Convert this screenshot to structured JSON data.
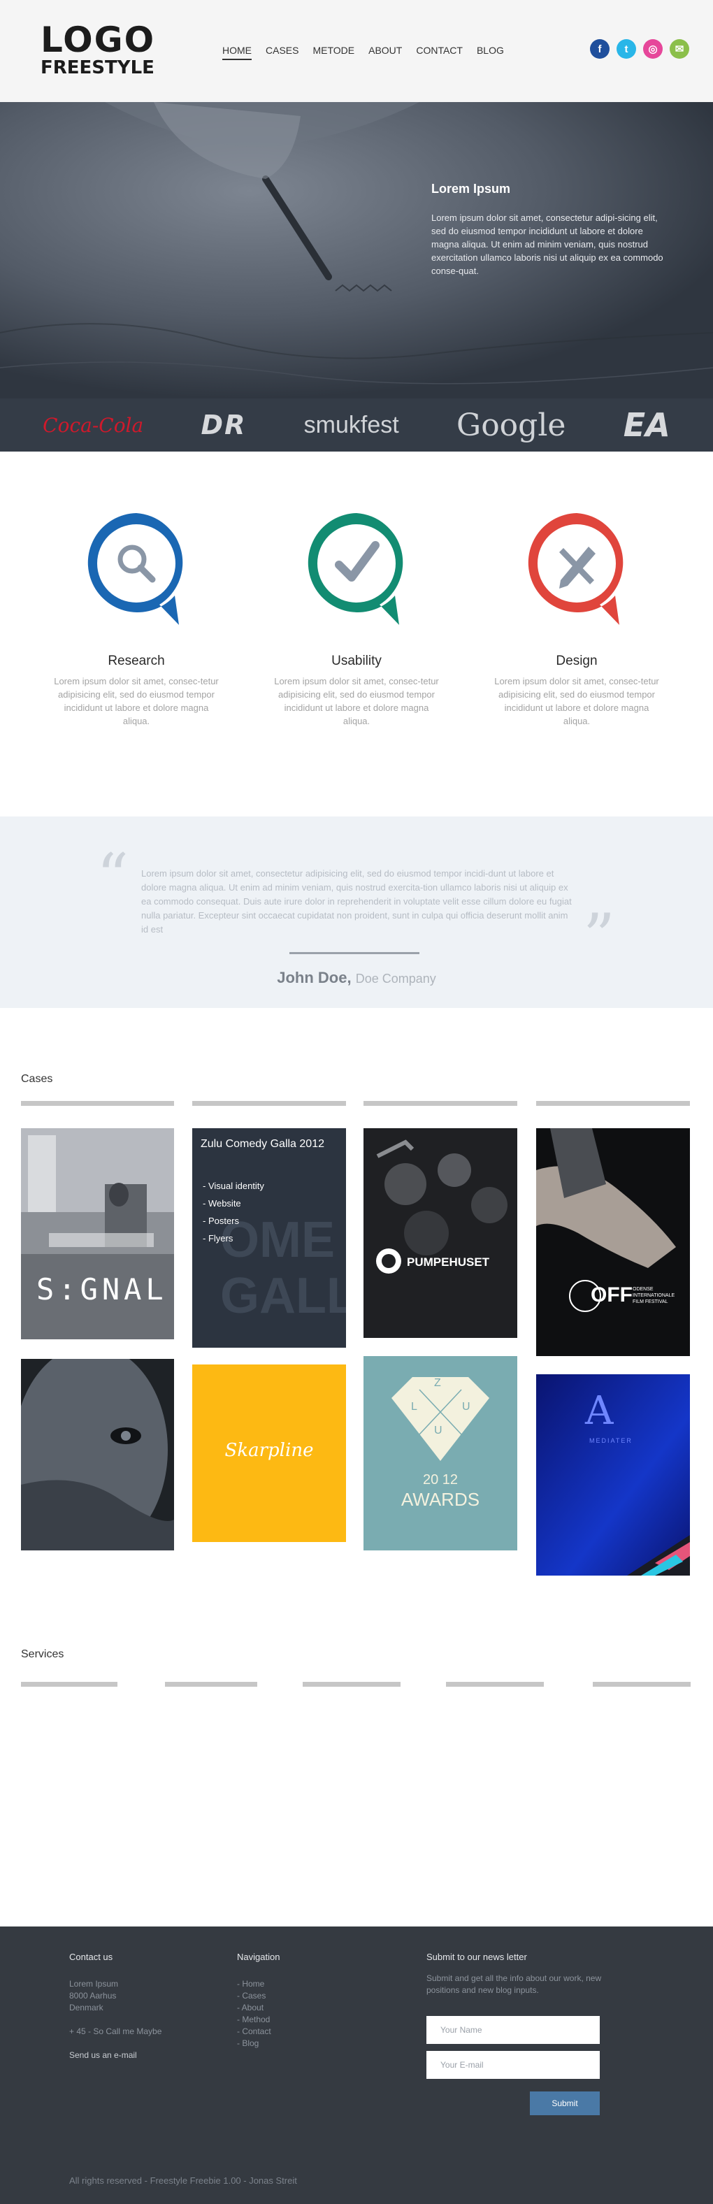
{
  "header": {
    "logo_main": "LOGO",
    "logo_sub": "FREESTYLE",
    "nav": [
      "HOME",
      "CASES",
      "METODE",
      "ABOUT",
      "CONTACT",
      "BLOG"
    ],
    "active_nav": "HOME",
    "social": [
      {
        "icon": "facebook-icon",
        "glyph": "f",
        "color": "#1f4f9c"
      },
      {
        "icon": "twitter-icon",
        "glyph": "t",
        "color": "#29b6e8"
      },
      {
        "icon": "dribbble-icon",
        "glyph": "◎",
        "color": "#e6479a"
      },
      {
        "icon": "mail-icon",
        "glyph": "✉",
        "color": "#8bbf4a"
      }
    ]
  },
  "hero": {
    "title": "Lorem Ipsum",
    "text": "Lorem ipsum dolor sit amet, consectetur adipi-sicing elit, sed do eiusmod tempor incididunt ut labore et dolore magna aliqua. Ut enim ad minim veniam, quis nostrud exercitation ullamco laboris nisi ut aliquip ex ea commodo conse-quat."
  },
  "clients": [
    "Coca-Cola",
    "DR",
    "smukfest",
    "Google",
    "EA"
  ],
  "features": [
    {
      "title": "Research",
      "icon": "search-icon",
      "color": "#1a67b3",
      "text": "Lorem ipsum dolor sit amet, consec-tetur adipisicing elit, sed do eiusmod tempor incididunt ut labore et dolore magna aliqua."
    },
    {
      "title": "Usability",
      "icon": "checkmark-icon",
      "color": "#128c72",
      "text": "Lorem ipsum dolor sit amet, consec-tetur adipisicing elit, sed do eiusmod tempor incididunt ut labore et dolore magna aliqua."
    },
    {
      "title": "Design",
      "icon": "pencil-brush-icon",
      "color": "#e0453c",
      "text": "Lorem ipsum dolor sit amet, consec-tetur adipisicing elit, sed do eiusmod tempor incididunt ut labore et dolore magna aliqua."
    }
  ],
  "testimonial": {
    "text": "Lorem ipsum dolor sit amet, consectetur adipisicing elit, sed do eiusmod tempor incidi-dunt ut labore et dolore magna aliqua. Ut enim ad minim veniam, quis nostrud exercita-tion ullamco laboris nisi ut aliquip ex ea commodo consequat. Duis aute irure dolor in reprehenderit in voluptate velit esse cillum dolore eu fugiat nulla pariatur. Excepteur sint occaecat cupidatat non proident, sunt in culpa qui officia deserunt mollit anim id est",
    "author": "John Doe,",
    "company": "Doe Company"
  },
  "cases": {
    "title": "Cases",
    "signal_label": "S:GNAL",
    "zulu_title": "Zulu Comedy Galla 2012",
    "zulu_items": [
      "- Visual identity",
      "- Website",
      "- Posters",
      "- Flyers"
    ],
    "pumpehuset_label": "PUMPEHUSET",
    "off_label": "OFF",
    "off_sub": "ODENSE INTERNATIONALE FILM FESTIVAL",
    "skarpline_label": "Skarpline",
    "awards_top": "20  12",
    "awards_label": "AWARDS",
    "awards_letters": [
      "Z",
      "L",
      "X",
      "U",
      "U"
    ],
    "mediater_letter": "A",
    "mediater_label": "MEDIATER"
  },
  "services": {
    "title": "Services"
  },
  "footer": {
    "contact_title": "Contact us",
    "address": [
      "Lorem Ipsum",
      "8000 Aarhus",
      "Denmark"
    ],
    "phone": "+ 45 - So Call me Maybe",
    "email_link": "Send us an e-mail",
    "nav_title": "Navigation",
    "nav_items": [
      "- Home",
      "- Cases",
      "- About",
      "- Method",
      "- Contact",
      "- Blog"
    ],
    "news_title": "Submit to our news letter",
    "news_text": "Submit and get all the info about our work, new positions and new blog inputs.",
    "name_placeholder": "Your Name",
    "email_placeholder": "Your E-mail",
    "submit_label": "Submit",
    "copyright": "All rights reserved - Freestyle Freebie 1.00 - Jonas Streit"
  }
}
